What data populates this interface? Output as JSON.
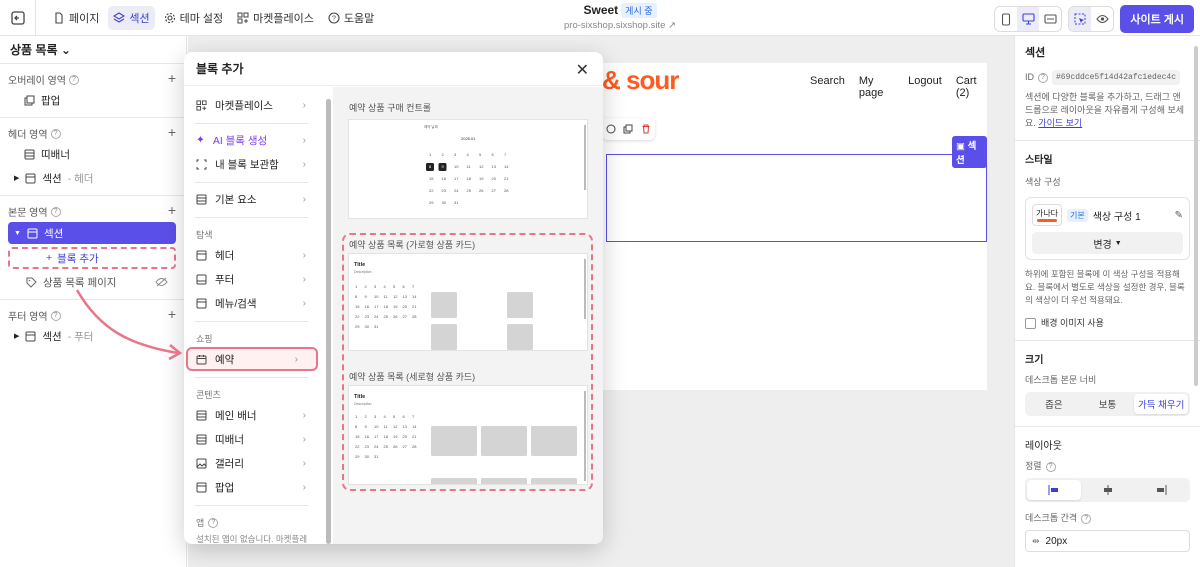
{
  "topbar": {
    "nav": [
      {
        "label": "페이지",
        "icon": "file-icon"
      },
      {
        "label": "섹션",
        "icon": "layers-icon",
        "active": true
      },
      {
        "label": "테마 설정",
        "icon": "gear-icon"
      },
      {
        "label": "마켓플레이스",
        "icon": "apps-icon"
      },
      {
        "label": "도움말",
        "icon": "help-icon"
      }
    ],
    "site_name": "Sweet",
    "status_badge": "게시 중",
    "site_url": "pro-sixshop.sixshop.site",
    "publish_label": "사이트 게시"
  },
  "left_panel": {
    "title": "상품 목록",
    "overlay": {
      "label": "오버레이 영역",
      "items": [
        {
          "label": "팝업"
        }
      ]
    },
    "header": {
      "label": "헤더 영역",
      "items": [
        {
          "label": "띠배너"
        },
        {
          "label": "섹션",
          "sub": "- 헤더"
        }
      ]
    },
    "body": {
      "label": "본문 영역",
      "selected_item": "섹션",
      "add_block": "블록 추가",
      "page_item": "상품 목록 페이지"
    },
    "footer": {
      "label": "푸터 영역",
      "items": [
        {
          "label": "섹션",
          "sub": "- 푸터"
        }
      ]
    }
  },
  "preview": {
    "logo_text": "& sour",
    "nav": [
      "Search",
      "My page",
      "Logout",
      "Cart (2)"
    ],
    "section_tag": "섹션"
  },
  "modal": {
    "title": "블록 추가",
    "top_items": [
      "마켓플레이스",
      "AI 블록 생성",
      "내 블록 보관함"
    ],
    "basic_item": "기본 요소",
    "nav_group": "탐색",
    "nav_items": [
      "헤더",
      "푸터",
      "메뉴/검색"
    ],
    "shop_group": "쇼핑",
    "shop_selected": "예약",
    "content_group": "콘텐츠",
    "content_items": [
      "메인 배너",
      "띠배너",
      "갤러리",
      "팝업"
    ],
    "app_group": "앱",
    "app_desc": "설치된 앱이 없습니다. 마켓플레이스에서 필요한 앱을 설치하고 웹사이트",
    "templates": [
      {
        "title": "예약 상품 구매 컨트롤"
      },
      {
        "title": "예약 상품 목록 (가로형 상품 카드)",
        "card_title": "Title",
        "card_desc": "Description"
      },
      {
        "title": "예약 상품 목록 (세로형 상품 카드)",
        "card_title": "Title",
        "card_desc": "Description"
      }
    ],
    "calendar_month": "2026.01"
  },
  "right_panel": {
    "title": "섹션",
    "id_label": "ID",
    "id_value": "#69cddce5f14d42afc1edec4c",
    "desc": "섹션에 다양한 블록을 추가하고, 드래그 앤 드롭으로 레이아웃을 자유롭게 구성해 보세요.",
    "guide_link": "가이드 보기",
    "style_title": "스타일",
    "color_config_label": "색상 구성",
    "swatch_text": "가나다",
    "default_badge": "기본",
    "color_config_value": "색상 구성 1",
    "change_button": "변경",
    "color_note": "하위에 포함된 블록에 이 색상 구성을 적용해요. 블록에서 별도로 색상을 설정한 경우, 블록의 색상이 더 우선 적용돼요.",
    "bg_image_label": "배경 이미지 사용",
    "size_title": "크기",
    "width_label": "데스크톱 본문 너비",
    "width_options": [
      "좁은",
      "보통",
      "가득 채우기"
    ],
    "layout_title": "레이아웃",
    "align_label": "정렬",
    "spacing_label": "데스크톱 간격",
    "spacing_value": "20px"
  }
}
